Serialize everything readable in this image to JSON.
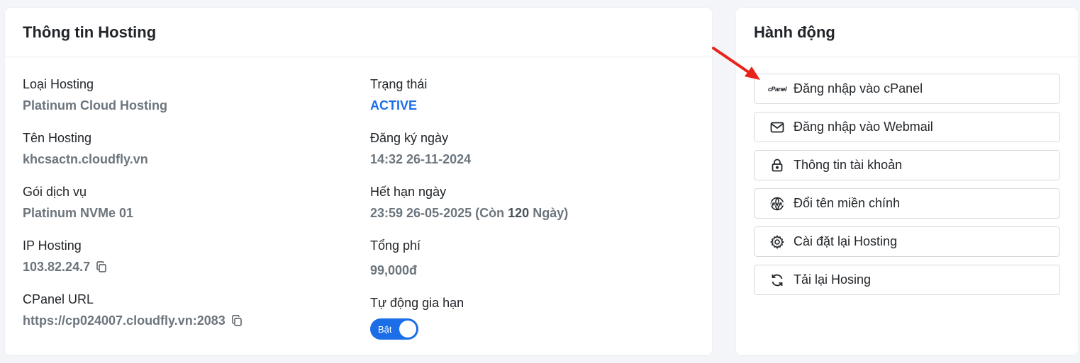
{
  "info": {
    "title": "Thông tin Hosting",
    "left": [
      {
        "label": "Loại Hosting",
        "value": "Platinum Cloud Hosting"
      },
      {
        "label": "Tên Hosting",
        "value": "khcsactn.cloudfly.vn"
      },
      {
        "label": "Gói dịch vụ",
        "value": "Platinum NVMe 01"
      },
      {
        "label": "IP Hosting",
        "value": "103.82.24.7"
      },
      {
        "label": "CPanel URL",
        "value": "https://cp024007.cloudfly.vn:2083"
      }
    ],
    "status": {
      "label": "Trạng thái",
      "value": "ACTIVE"
    },
    "registered": {
      "label": "Đăng ký ngày",
      "value": "14:32 26-11-2024"
    },
    "expiry": {
      "label": "Hết hạn ngày",
      "date": "23:59 26-05-2025",
      "remaining_prefix": "(Còn",
      "remaining_days": "120",
      "remaining_suffix": "Ngày)"
    },
    "total": {
      "label": "Tổng phí",
      "value": "99,000đ"
    },
    "autorenew": {
      "label": "Tự động gia hạn",
      "toggle_text": "Bật",
      "enabled": true
    }
  },
  "actions": {
    "title": "Hành động",
    "items": [
      {
        "label": "Đăng nhập vào cPanel",
        "icon": "cpanel-icon",
        "logo_text": "cPanel"
      },
      {
        "label": "Đăng nhập vào Webmail",
        "icon": "envelope-icon"
      },
      {
        "label": "Thông tin tài khoản",
        "icon": "lock-icon"
      },
      {
        "label": "Đổi tên miền chính",
        "icon": "www-globe-icon"
      },
      {
        "label": "Cài đặt lại Hosting",
        "icon": "gear-icon"
      },
      {
        "label": "Tải lại Hosing",
        "icon": "refresh-icon"
      }
    ]
  },
  "colors": {
    "accent": "#1b6ee8",
    "annotation_arrow": "#e8231c"
  }
}
